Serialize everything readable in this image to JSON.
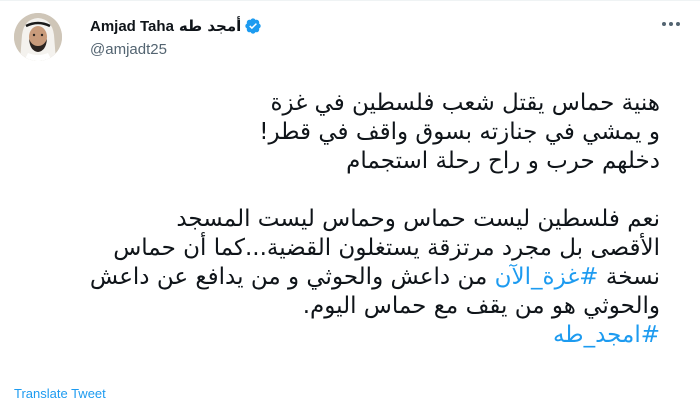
{
  "author": {
    "display_name": "Amjad Taha",
    "display_name_ar": "أمجد طه",
    "handle": "@amjadt25",
    "verified": true,
    "avatar_icon": "profile-photo"
  },
  "tweet": {
    "lines": [
      "هنية حماس يقتل شعب فلسطين في غزة",
      "و يمشي في جنازته بسوق واقف في قطر!",
      "دخلهم حرب و راح رحلة استجمام",
      "نعم فلسطين ليست حماس وحماس ليست المسجد",
      "الأقصى بل مجرد مرتزقة يستغلون القضية...كما أن حماس",
      "من داعش والحوثي و من يدافع عن داعش",
      "والحوثي هو من يقف مع حماس اليوم."
    ],
    "line6_prefix": "نسخة",
    "hashtag_1": "#غزة_الآن",
    "hashtag_2": "#امجد_طه"
  },
  "actions": {
    "translate_label": "Translate Tweet",
    "more_icon": "more-horizontal-icon"
  },
  "colors": {
    "link": "#1d9bf0",
    "text": "#0f1419",
    "secondary": "#536471"
  }
}
